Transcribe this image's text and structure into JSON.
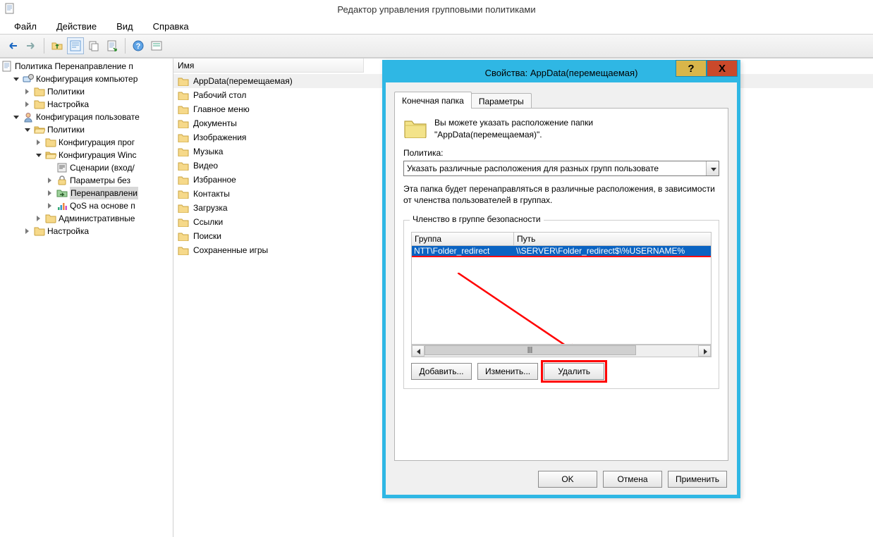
{
  "window": {
    "title": "Редактор управления групповыми политиками"
  },
  "menu": {
    "file": "Файл",
    "action": "Действие",
    "view": "Вид",
    "help": "Справка"
  },
  "tree": {
    "root": "Политика Перенаправление п",
    "computer_cfg": "Конфигурация компьютер",
    "c_policies": "Политики",
    "c_settings": "Настройка",
    "user_cfg": "Конфигурация пользовате",
    "u_policies": "Политики",
    "cfg_programs": "Конфигурация прог",
    "cfg_windows": "Конфигурация Winc",
    "scenarios": "Сценарии (вход/",
    "sec_params": "Параметры без",
    "redirect": "Перенаправлени",
    "qos": "QoS на основе п",
    "admin_tpl": "Административные",
    "u_settings": "Настройка"
  },
  "list": {
    "header": "Имя",
    "items": [
      "AppData(перемещаемая)",
      "Рабочий стол",
      "Главное меню",
      "Документы",
      "Изображения",
      "Музыка",
      "Видео",
      "Избранное",
      "Контакты",
      "Загрузка",
      "Ссылки",
      "Поиски",
      "Сохраненные игры"
    ]
  },
  "dialog": {
    "title": "Свойства: AppData(перемещаемая)",
    "help": "?",
    "close": "X",
    "tabs": {
      "target": "Конечная папка",
      "params": "Параметры"
    },
    "intro": "Вы можете указать расположение папки \"AppData(перемещаемая)\".",
    "policy_label": "Политика:",
    "policy_value": "Указать различные расположения для разных групп пользовате",
    "redirect_desc": "Эта папка будет перенаправляться в различные расположения, в зависимости от членства пользователей в группах.",
    "group_box_title": "Членство в группе безопасности",
    "grid": {
      "col1": "Группа",
      "col2": "Путь",
      "row_group": "NTT\\Folder_redirect",
      "row_path": "\\\\SERVER\\Folder_redirect$\\%USERNAME%"
    },
    "buttons": {
      "add": "Добавить...",
      "edit": "Изменить...",
      "delete": "Удалить"
    },
    "footer": {
      "ok": "OK",
      "cancel": "Отмена",
      "apply": "Применить"
    }
  }
}
